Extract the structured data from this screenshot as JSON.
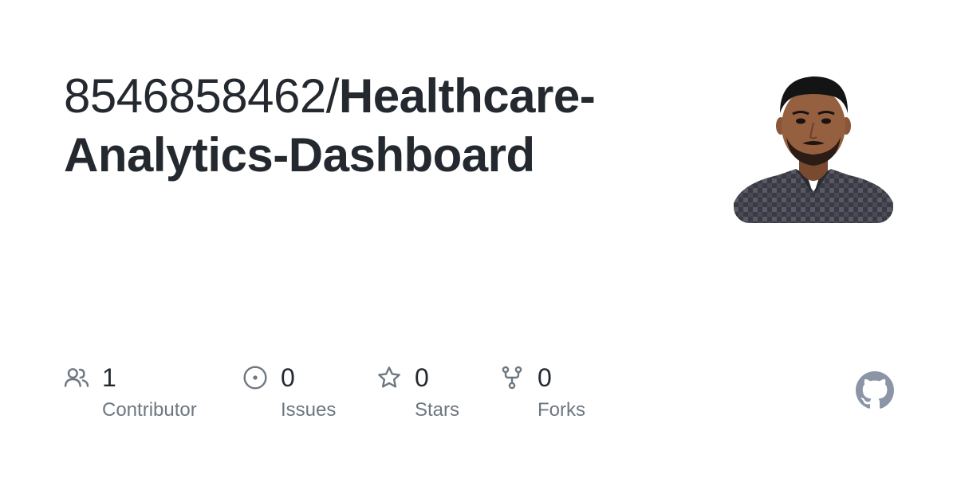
{
  "repo": {
    "owner": "8546858462/",
    "name": "Healthcare-Analytics-Dashboard"
  },
  "stats": {
    "contributors": {
      "count": "1",
      "label": "Contributor",
      "icon": "people-icon"
    },
    "issues": {
      "count": "0",
      "label": "Issues",
      "icon": "issue-opened-icon"
    },
    "stars": {
      "count": "0",
      "label": "Stars",
      "icon": "star-icon"
    },
    "forks": {
      "count": "0",
      "label": "Forks",
      "icon": "repo-forked-icon"
    }
  },
  "colors": {
    "title": "#24292f",
    "muted": "#6e7781",
    "icon": "#6e7781",
    "github_mark": "#8b95a6"
  }
}
